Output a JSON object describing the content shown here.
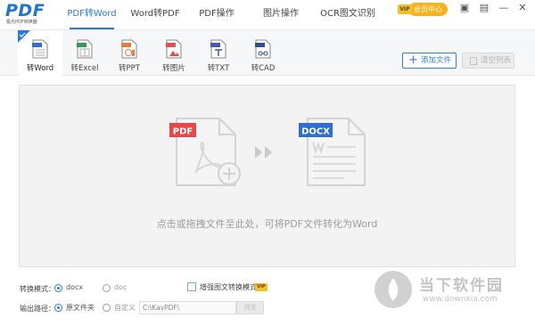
{
  "app": {
    "logo_text": "PDF",
    "logo_subtitle": "极光PDF转换器"
  },
  "nav": {
    "tabs": [
      {
        "label": "PDF转Word",
        "active": true
      },
      {
        "label": "Word转PDF",
        "active": false
      },
      {
        "label": "PDF操作",
        "active": false
      },
      {
        "label": "图片操作",
        "active": false
      },
      {
        "label": "OCR图文识别",
        "active": false
      }
    ],
    "vip_badge": "VIP",
    "member_center": "会员中心"
  },
  "window_controls": {
    "icons": [
      "display-icon",
      "shirt-skin-icon",
      "minimize-icon",
      "close-icon"
    ],
    "glyphs": [
      "▣",
      "▤",
      "—",
      "✕"
    ]
  },
  "formats": [
    {
      "label": "转Word",
      "badge": "W",
      "color": "#2f6fd1",
      "active": true
    },
    {
      "label": "转Excel",
      "badge": "XLS",
      "color": "#2e9b5c",
      "active": false
    },
    {
      "label": "转PPT",
      "badge": "PPT",
      "color": "#e57a45",
      "active": false
    },
    {
      "label": "转图片",
      "badge": "IMG",
      "color": "#e25050",
      "active": false
    },
    {
      "label": "转TXT",
      "badge": "TXT",
      "color": "#4b57a8",
      "active": false
    },
    {
      "label": "转CAD",
      "badge": "DWG",
      "color": "#2b4f8f",
      "active": false
    }
  ],
  "toolbar": {
    "add_file_label": "添加文件",
    "clear_list_label": "清空列表"
  },
  "dropzone": {
    "source_badge": "PDF",
    "target_badge": "DOCX",
    "hint": "点击或拖拽文件至此处，可将PDF文件转化为Word"
  },
  "options": {
    "mode_label": "转换模式：",
    "mode_docx": "docx",
    "mode_doc": "doc",
    "mode_selected": "docx",
    "enhanced_label": "增强图文转换模式",
    "enhanced_vip": "VIP",
    "enhanced_checked": false,
    "output_label": "输出路径：",
    "output_original": "原文件夹",
    "output_custom": "自定义",
    "output_selected": "原文件夹",
    "custom_path": "C:\\KavPDF\\",
    "browse_label": "浏览"
  },
  "watermark": {
    "title": "当下软件园",
    "url": "www.downxia.com"
  },
  "colors": {
    "accent": "#2a7ad5",
    "pdf_red": "#e64848",
    "docx_blue": "#2e6fd0",
    "vip_gold": "#f6b31d"
  }
}
